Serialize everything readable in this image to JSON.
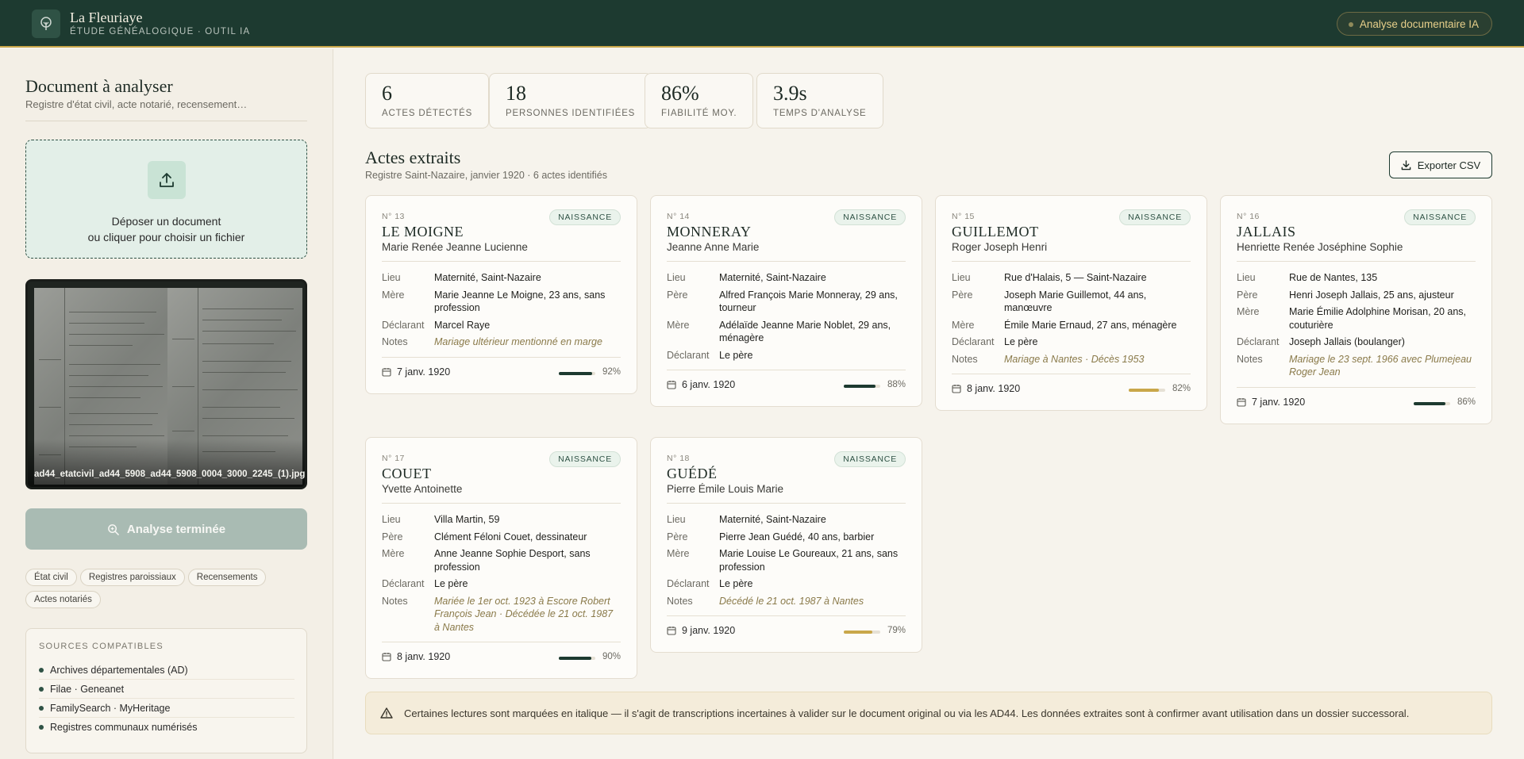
{
  "header": {
    "brand_name": "La Fleuriaye",
    "brand_sub": "Étude généalogique · Outil IA",
    "pill_label": "Analyse documentaire IA"
  },
  "sidebar": {
    "title": "Document à analyser",
    "subtitle": "Registre d'état civil, acte notarié, recensement…",
    "drop_line1": "Déposer un document",
    "drop_line2": "ou cliquer pour choisir un fichier",
    "filename": "ad44_etatcivil_ad44_5908_ad44_5908_0004_3000_2245_(1).jpg",
    "analyze_button": "Analyse terminée",
    "chips": [
      "État civil",
      "Registres paroissiaux",
      "Recensements",
      "Actes notariés"
    ],
    "sources_title": "Sources compatibles",
    "sources": [
      "Archives départementales (AD)",
      "Filae · Geneanet",
      "FamilySearch · MyHeritage",
      "Registres communaux numérisés"
    ]
  },
  "stats": [
    {
      "value": "6",
      "label": "Actes détectés"
    },
    {
      "value": "18",
      "label": "Personnes identifiées"
    },
    {
      "value": "86%",
      "label": "Fiabilité moy."
    },
    {
      "value": "3.9s",
      "label": "Temps d'analyse"
    }
  ],
  "section": {
    "title": "Actes extraits",
    "subtitle": "Registre Saint-Nazaire, janvier 1920 · 6 actes identifiés",
    "export_label": "Exporter CSV"
  },
  "acts": [
    {
      "number": "N° 13",
      "surname": "LE MOIGNE",
      "given": "Marie Renée Jeanne Lucienne",
      "type": "Naissance",
      "fields": [
        {
          "k": "Lieu",
          "v": "Maternité, Saint-Nazaire"
        },
        {
          "k": "Mère",
          "v": "Marie Jeanne Le Moigne, 23 ans, sans profession"
        },
        {
          "k": "Déclarant",
          "v": "Marcel Raye"
        },
        {
          "k": "Notes",
          "v": "Mariage ultérieur mentionné en marge",
          "note": true
        }
      ],
      "date": "7 janv. 1920",
      "confidence": 92,
      "conf_label": "92%"
    },
    {
      "number": "N° 14",
      "surname": "MONNERAY",
      "given": "Jeanne Anne Marie",
      "type": "Naissance",
      "fields": [
        {
          "k": "Lieu",
          "v": "Maternité, Saint-Nazaire"
        },
        {
          "k": "Père",
          "v": "Alfred François Marie Monneray, 29 ans, tourneur"
        },
        {
          "k": "Mère",
          "v": "Adélaïde Jeanne Marie Noblet, 29 ans, ménagère"
        },
        {
          "k": "Déclarant",
          "v": "Le père"
        }
      ],
      "date": "6 janv. 1920",
      "confidence": 88,
      "conf_label": "88%"
    },
    {
      "number": "N° 15",
      "surname": "GUILLEMOT",
      "given": "Roger Joseph Henri",
      "type": "Naissance",
      "fields": [
        {
          "k": "Lieu",
          "v": "Rue d'Halais, 5 — Saint-Nazaire"
        },
        {
          "k": "Père",
          "v": "Joseph Marie Guillemot, 44 ans, manœuvre"
        },
        {
          "k": "Mère",
          "v": "Émile Marie Ernaud, 27 ans, ménagère"
        },
        {
          "k": "Déclarant",
          "v": "Le père"
        },
        {
          "k": "Notes",
          "v": "Mariage à Nantes · Décès 1953",
          "note": true
        }
      ],
      "date": "8 janv. 1920",
      "confidence": 82,
      "conf_label": "82%"
    },
    {
      "number": "N° 16",
      "surname": "JALLAIS",
      "given": "Henriette Renée Joséphine Sophie",
      "type": "Naissance",
      "fields": [
        {
          "k": "Lieu",
          "v": "Rue de Nantes, 135"
        },
        {
          "k": "Père",
          "v": "Henri Joseph Jallais, 25 ans, ajusteur"
        },
        {
          "k": "Mère",
          "v": "Marie Émilie Adolphine Morisan, 20 ans, couturière"
        },
        {
          "k": "Déclarant",
          "v": "Joseph Jallais (boulanger)"
        },
        {
          "k": "Notes",
          "v": "Mariage le 23 sept. 1966 avec Plumejeau Roger Jean",
          "note": true
        }
      ],
      "date": "7 janv. 1920",
      "confidence": 86,
      "conf_label": "86%"
    },
    {
      "number": "N° 17",
      "surname": "COUET",
      "given": "Yvette Antoinette",
      "type": "Naissance",
      "fields": [
        {
          "k": "Lieu",
          "v": "Villa Martin, 59"
        },
        {
          "k": "Père",
          "v": "Clément Féloni Couet, dessinateur"
        },
        {
          "k": "Mère",
          "v": "Anne Jeanne Sophie Desport, sans profession"
        },
        {
          "k": "Déclarant",
          "v": "Le père"
        },
        {
          "k": "Notes",
          "v": "Mariée le 1er oct. 1923 à Escore Robert François Jean · Décédée le 21 oct. 1987 à Nantes",
          "note": true
        }
      ],
      "date": "8 janv. 1920",
      "confidence": 90,
      "conf_label": "90%"
    },
    {
      "number": "N° 18",
      "surname": "GUÉDÉ",
      "given": "Pierre Émile Louis Marie",
      "type": "Naissance",
      "fields": [
        {
          "k": "Lieu",
          "v": "Maternité, Saint-Nazaire"
        },
        {
          "k": "Père",
          "v": "Pierre Jean Guédé, 40 ans, barbier"
        },
        {
          "k": "Mère",
          "v": "Marie Louise Le Goureaux, 21 ans, sans profession"
        },
        {
          "k": "Déclarant",
          "v": "Le père"
        },
        {
          "k": "Notes",
          "v": "Décédé le 21 oct. 1987 à Nantes",
          "note": true
        }
      ],
      "date": "9 janv. 1920",
      "confidence": 79,
      "conf_label": "79%"
    }
  ],
  "notice": "Certaines lectures sont marquées en italique — il s'agit de transcriptions incertaines à valider sur le document original ou via les AD44. Les données extraites sont à confirmer avant utilisation dans un dossier successoral.",
  "colors": {
    "header_bg": "#1d3a30",
    "accent_gold": "#c9a74a",
    "high_confidence": "#1d3a30",
    "medium_confidence": "#c9a74a"
  }
}
